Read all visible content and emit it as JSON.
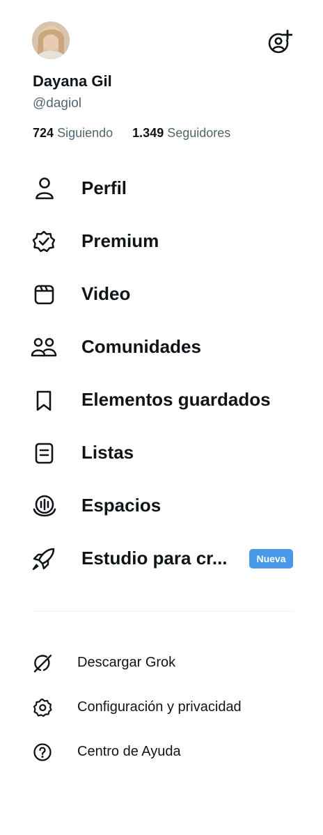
{
  "profile": {
    "name": "Dayana Gil",
    "handle": "@dagiol",
    "following_count": "724",
    "following_label": "Siguiendo",
    "followers_count": "1.349",
    "followers_label": "Seguidores"
  },
  "menu": {
    "items": [
      {
        "label": "Perfil",
        "icon": "person-icon"
      },
      {
        "label": "Premium",
        "icon": "verified-badge-icon"
      },
      {
        "label": "Video",
        "icon": "video-icon"
      },
      {
        "label": "Comunidades",
        "icon": "communities-icon"
      },
      {
        "label": "Elementos guardados",
        "icon": "bookmark-icon"
      },
      {
        "label": "Listas",
        "icon": "list-icon"
      },
      {
        "label": "Espacios",
        "icon": "spaces-icon"
      },
      {
        "label": "Estudio para cr...",
        "icon": "rocket-icon",
        "badge": "Nueva"
      }
    ]
  },
  "secondary": {
    "items": [
      {
        "label": "Descargar Grok",
        "icon": "grok-icon"
      },
      {
        "label": "Configuración y privacidad",
        "icon": "gear-icon"
      },
      {
        "label": "Centro de Ayuda",
        "icon": "help-icon"
      }
    ]
  },
  "colors": {
    "text": "#0f1419",
    "secondary_text": "#536471",
    "badge": "#4a99e9",
    "divider": "#eff3f4"
  }
}
